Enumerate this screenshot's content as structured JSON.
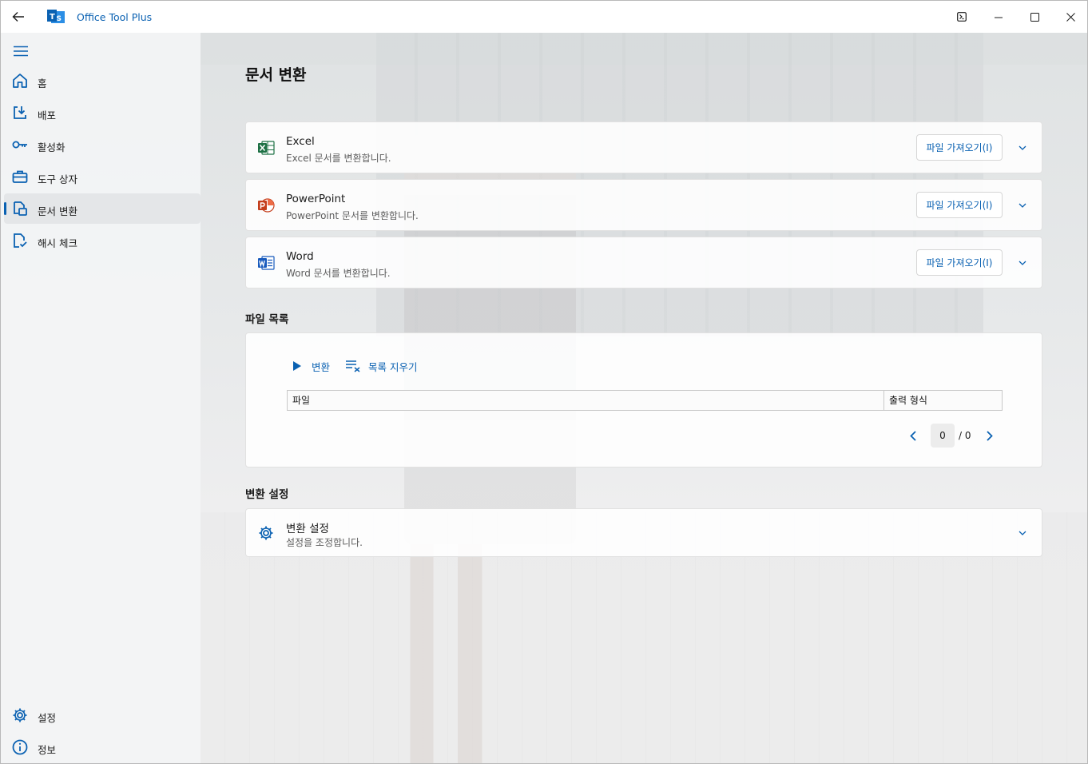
{
  "app": {
    "title": "Office Tool Plus",
    "accent": "#0a61b2"
  },
  "titlebar": {
    "back_icon": "arrow-left-icon",
    "buttons": [
      "terminal-icon",
      "minimize-icon",
      "maximize-icon",
      "close-icon"
    ]
  },
  "sidebar": {
    "items": [
      {
        "label": "홈",
        "icon": "home-icon"
      },
      {
        "label": "배포",
        "icon": "download-icon"
      },
      {
        "label": "활성화",
        "icon": "key-icon"
      },
      {
        "label": "도구 상자",
        "icon": "toolbox-icon"
      },
      {
        "label": "문서 변환",
        "icon": "document-convert-icon",
        "active": true
      },
      {
        "label": "해시 체크",
        "icon": "hash-check-icon"
      }
    ],
    "footer": [
      {
        "label": "설정",
        "icon": "gear-icon"
      },
      {
        "label": "정보",
        "icon": "info-icon"
      }
    ]
  },
  "main": {
    "title": "문서 변환",
    "converters": [
      {
        "name": "Excel",
        "description": "Excel 문서를 변환합니다.",
        "button": "파일 가져오기(I)",
        "color": "#1d7044"
      },
      {
        "name": "PowerPoint",
        "description": "PowerPoint 문서를 변환합니다.",
        "button": "파일 가져오기(I)",
        "color": "#c43e1c"
      },
      {
        "name": "Word",
        "description": "Word 문서를 변환합니다.",
        "button": "파일 가져오기(I)",
        "color": "#185abd"
      }
    ],
    "file_list": {
      "section_title": "파일 목록",
      "convert_label": "변환",
      "clear_label": "목록 지우기",
      "columns": [
        "파일",
        "출력 형식"
      ],
      "page_current": "0",
      "page_total": "/ 0"
    },
    "settings": {
      "section_title": "변환 설정",
      "title": "변환 설정",
      "description": "설정을 조정합니다."
    }
  }
}
